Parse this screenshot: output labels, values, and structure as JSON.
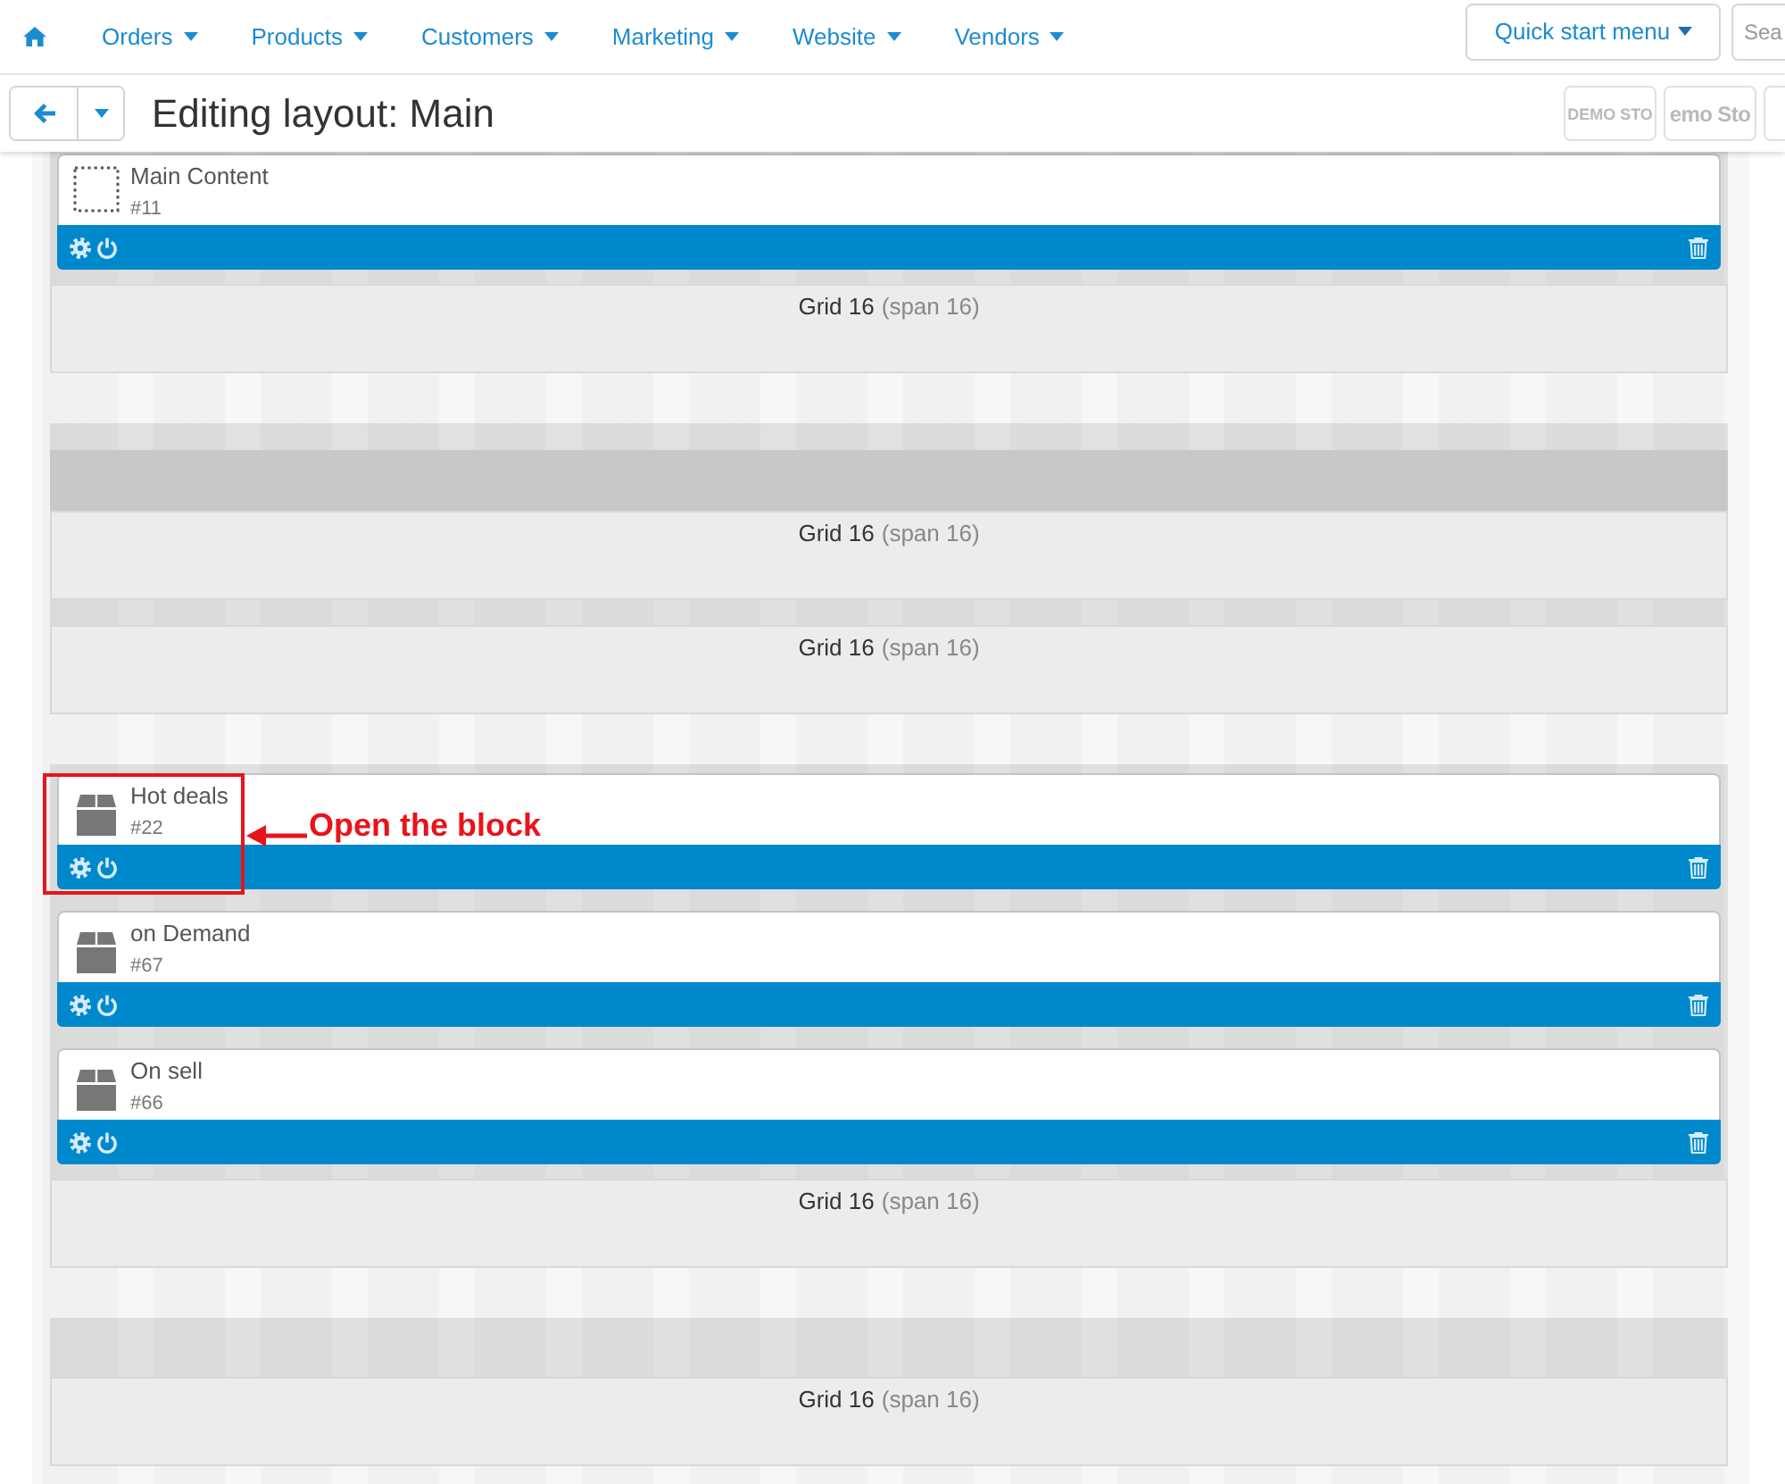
{
  "top_nav": {
    "items": [
      {
        "label": "Orders"
      },
      {
        "label": "Products"
      },
      {
        "label": "Customers"
      },
      {
        "label": "Marketing"
      },
      {
        "label": "Website"
      },
      {
        "label": "Vendors"
      }
    ],
    "quick_start": "Quick start menu",
    "search": {
      "placeholder": "Sea"
    }
  },
  "toolbar": {
    "title": "Editing layout: Main",
    "store_logos": [
      {
        "kind": "small",
        "text": "DEMO STO"
      },
      {
        "kind": "large",
        "text": "emo Sto"
      },
      {
        "kind": "blank"
      }
    ]
  },
  "containers": [
    {
      "grids": [
        {
          "highlighted": false,
          "blocks": [
            {
              "kind": "content",
              "name": "Main Content",
              "id": "#11"
            }
          ],
          "title": "Grid 16",
          "span": "(span 16)"
        }
      ]
    },
    {
      "grids": [
        {
          "highlighted": true,
          "title": "Grid 16",
          "span": "(span 16)"
        },
        {
          "highlighted": false,
          "title": "Grid 16",
          "span": "(span 16)"
        }
      ]
    },
    {
      "grids": [
        {
          "highlighted": false,
          "blocks": [
            {
              "kind": "box",
              "name": "Hot deals",
              "id": "#22",
              "callout": "Open the block"
            },
            {
              "kind": "box",
              "name": "on Demand",
              "id": "#67"
            },
            {
              "kind": "box",
              "name": "On sell",
              "id": "#66"
            }
          ],
          "title": "Grid 16",
          "span": "(span 16)"
        }
      ]
    },
    {
      "grids": [
        {
          "highlighted": false,
          "title": "Grid 16",
          "span": "(span 16)"
        }
      ]
    }
  ]
}
